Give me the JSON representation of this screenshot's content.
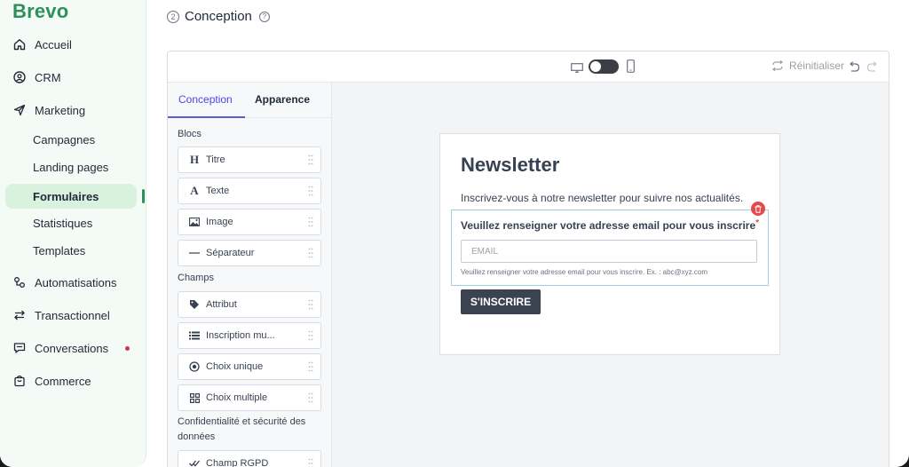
{
  "brand": {
    "logo_text": "Brevo",
    "accent": "#2f8f5b"
  },
  "sidebar": {
    "items": [
      {
        "label": "Accueil",
        "icon": "home-icon"
      },
      {
        "label": "CRM",
        "icon": "contact-icon"
      },
      {
        "label": "Marketing",
        "icon": "send-icon"
      },
      {
        "label": "Automatisations",
        "icon": "automation-icon"
      },
      {
        "label": "Transactionnel",
        "icon": "swap-icon"
      },
      {
        "label": "Conversations",
        "icon": "chat-icon"
      },
      {
        "label": "Commerce",
        "icon": "bag-icon"
      }
    ],
    "marketing_sub": [
      "Campagnes",
      "Landing pages",
      "Formulaires",
      "Statistiques",
      "Templates"
    ],
    "active_sub": "Formulaires"
  },
  "header": {
    "step": "2",
    "title": "Conception",
    "help": "?"
  },
  "toolbar": {
    "reset_label": "Réinitialiser"
  },
  "panel": {
    "tabs": [
      "Conception",
      "Apparence"
    ],
    "blocs_label": "Blocs",
    "blocs": [
      {
        "label": "Titre",
        "icon": "H"
      },
      {
        "label": "Texte",
        "icon": "A"
      },
      {
        "label": "Image",
        "icon": "image-icon"
      },
      {
        "label": "Séparateur",
        "icon": "divider-icon"
      }
    ],
    "champs_label": "Champs",
    "champs": [
      {
        "label": "Attribut",
        "icon": "tag-icon"
      },
      {
        "label": "Inscription mu...",
        "icon": "list-icon"
      },
      {
        "label": "Choix unique",
        "icon": "radio-icon"
      },
      {
        "label": "Choix multiple",
        "icon": "grid-icon"
      }
    ],
    "confidentialite_label": "Confidentialité et sécurité des données",
    "rgpd_label": "Champ RGPD"
  },
  "form": {
    "title": "Newsletter",
    "description": "Inscrivez-vous à notre newsletter pour suivre nos actualités.",
    "field_label": "Veuillez renseigner votre adresse email pour vous inscrire",
    "required_mark": "*",
    "email_placeholder": "EMAIL",
    "help_text": "Veuillez renseigner votre adresse email pour vous inscrire. Ex. : abc@xyz.com",
    "submit_label": "S'INSCRIRE"
  }
}
